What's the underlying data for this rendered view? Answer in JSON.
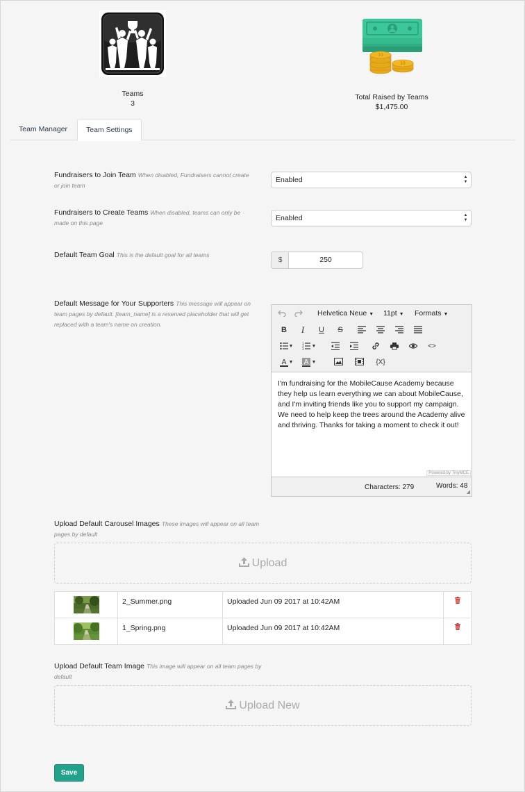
{
  "stats": {
    "teams_label": "Teams",
    "teams_value": "3",
    "raised_label": "Total Raised by Teams",
    "raised_value": "$1,475.00"
  },
  "tabs": [
    {
      "label": "Team Manager",
      "active": false
    },
    {
      "label": "Team Settings",
      "active": true
    }
  ],
  "settings": {
    "join": {
      "label": "Fundraisers to Join Team",
      "hint": "When disabled, Fundraisers cannot create or join team",
      "value": "Enabled"
    },
    "create": {
      "label": "Fundraisers to Create Teams",
      "hint": "When disabled, teams can only be made on this page",
      "value": "Enabled"
    },
    "goal": {
      "label": "Default Team Goal",
      "hint": "This is the default goal for all teams",
      "currency": "$",
      "value": "250"
    },
    "message": {
      "label": "Default Message for Your Supporters",
      "hint": "This message will appear on team pages by default. [team_name] is a reserved placeholder that will get replaced with a team's name on creation."
    }
  },
  "editor": {
    "font_family": "Helvetica Neue",
    "font_size": "11pt",
    "formats": "Formats",
    "content": "I'm fundraising for the MobileCause Academy because they help us learn everything we can about MobileCause, and I'm inviting friends like you to support my campaign. We need to help keep the trees around the Academy alive and thriving. Thanks for taking a moment to check it out!",
    "powered_by": "Powered by TinyMCE",
    "characters": "Characters: 279",
    "words": "Words: 48",
    "icons": [
      "undo-icon",
      "redo-icon",
      "bold-icon",
      "italic-icon",
      "underline-icon",
      "strikethrough-icon",
      "align-left-icon",
      "align-center-icon",
      "align-right-icon",
      "align-justify-icon",
      "bullet-list-icon",
      "numbered-list-icon",
      "outdent-icon",
      "indent-icon",
      "link-icon",
      "print-icon",
      "preview-icon",
      "code-icon",
      "text-color-icon",
      "background-color-icon",
      "image-icon",
      "media-icon",
      "placeholder-icon"
    ]
  },
  "carousel": {
    "label": "Upload Default Carousel Images",
    "hint": "These images will appear on all team pages by default",
    "upload_label": "Upload",
    "files": [
      {
        "name": "2_Summer.png",
        "uploaded": "Uploaded Jun 09 2017 at 10:42AM"
      },
      {
        "name": "1_Spring.png",
        "uploaded": "Uploaded Jun 09 2017 at 10:42AM"
      }
    ]
  },
  "team_image": {
    "label": "Upload Default Team Image",
    "hint": "This image will appear on all team pages by default",
    "upload_label": "Upload New"
  },
  "save_label": "Save",
  "colors": {
    "primary": "#23a28a",
    "delete": "#c9302c",
    "money_green": "#3cc79a",
    "coin_gold": "#f2b824"
  }
}
